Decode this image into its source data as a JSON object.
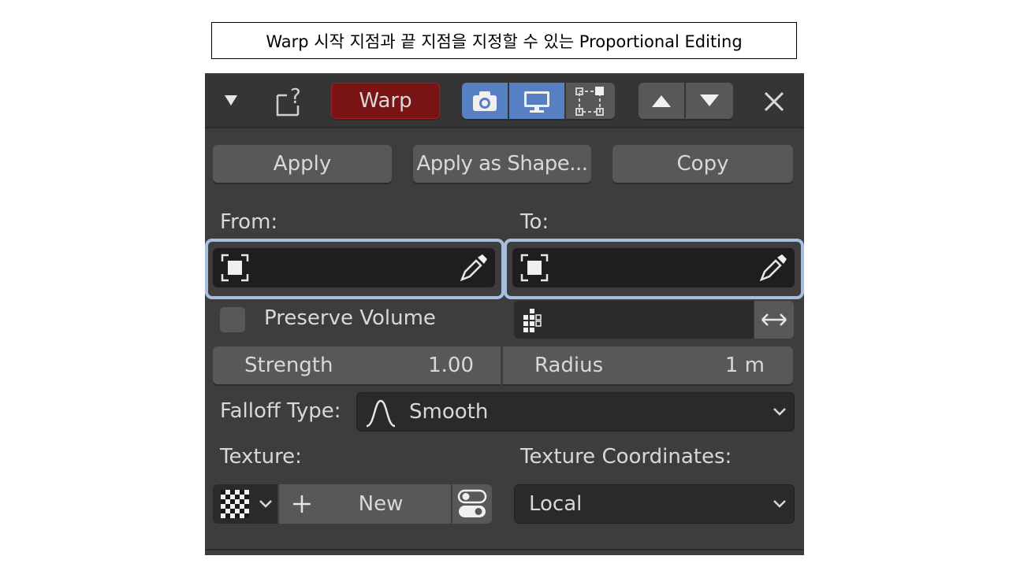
{
  "caption": "Warp 시작 지점과 끝 지점을 지정할 수 있는 Proportional Editing",
  "header": {
    "modifier_name": "Warp",
    "colors": {
      "name_bg": "#7a1414",
      "active_toggle": "#5680c2"
    },
    "icons": [
      "collapse-triangle-icon",
      "modifier-help-icon",
      "camera-icon",
      "monitor-icon",
      "editmode-vertices-icon",
      "move-up-icon",
      "move-down-icon",
      "close-icon"
    ]
  },
  "actions": {
    "apply": "Apply",
    "apply_shape": "Apply as Shape...",
    "copy": "Copy"
  },
  "from": {
    "label": "From:",
    "value": ""
  },
  "to": {
    "label": "To:",
    "value": ""
  },
  "preserve_volume": {
    "label": "Preserve Volume",
    "checked": false
  },
  "vertex_group": {
    "value": ""
  },
  "strength": {
    "label": "Strength",
    "value": "1.00"
  },
  "radius": {
    "label": "Radius",
    "value": "1 m"
  },
  "falloff": {
    "label": "Falloff Type:",
    "value": "Smooth"
  },
  "texture": {
    "label": "Texture:",
    "new_label": "New"
  },
  "texture_coords": {
    "label": "Texture Coordinates:",
    "value": "Local"
  }
}
